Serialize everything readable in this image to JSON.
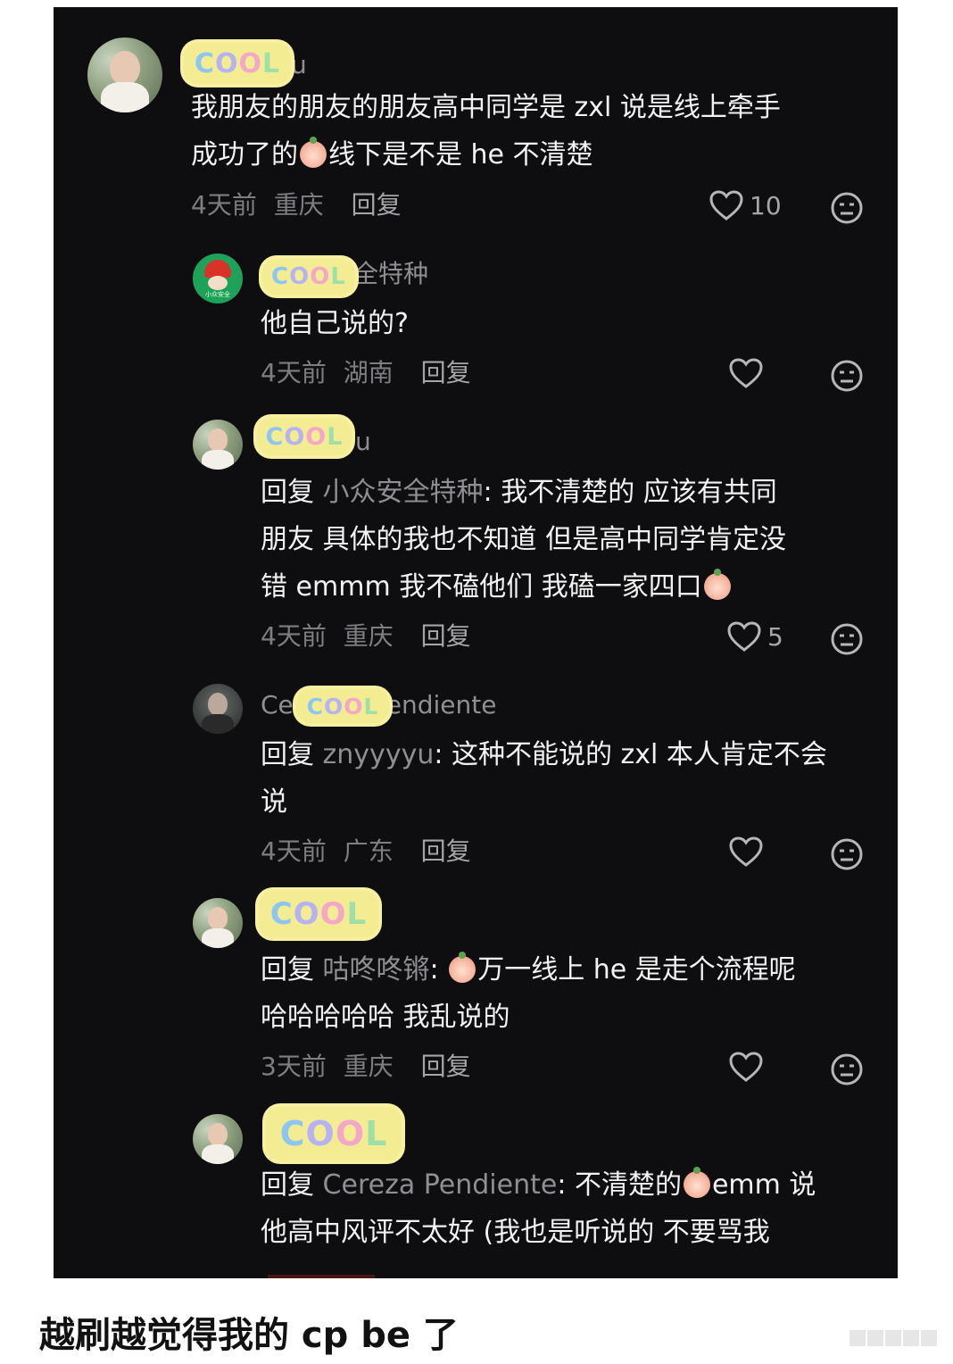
{
  "comments": [
    {
      "username_suffix": "u",
      "text_line1": "我朋友的朋友的朋友高中同学是 zxl 说是线上牵手",
      "text_line2a": "成功了的",
      "text_line2b": "线下是不是 he 不清楚",
      "time": "4天前",
      "location": "重庆",
      "reply_label": "回复",
      "likes": "10"
    },
    {
      "username_suffix": "全特种",
      "avatar_label": "小众安全",
      "text_line1": "他自己说的?",
      "time": "4天前",
      "location": "湖南",
      "reply_label": "回复",
      "likes": ""
    },
    {
      "username_suffix": "u",
      "reply_keyword": "回复",
      "reply_to": "小众安全特种",
      "text_line1": ": 我不清楚的  应该有共同",
      "text_line2": "朋友 具体的我也不知道  但是高中同学肯定没",
      "text_line3": "错 emmm 我不磕他们 我磕一家四口",
      "time": "4天前",
      "location": "重庆",
      "reply_label": "回复",
      "likes": "5"
    },
    {
      "username_prefix": "Ce",
      "username_suffix": "endiente",
      "reply_keyword": "回复",
      "reply_to": "znyyyyu",
      "text_line1": ": 这种不能说的 zxl 本人肯定不会",
      "text_line2": "说",
      "time": "4天前",
      "location": "广东",
      "reply_label": "回复",
      "likes": ""
    },
    {
      "reply_keyword": "回复",
      "reply_to": "咕咚咚锵",
      "text_line1": "万一线上 he 是走个流程呢",
      "text_line2": "哈哈哈哈哈 我乱说的",
      "time": "3天前",
      "location": "重庆",
      "reply_label": "回复",
      "likes": ""
    },
    {
      "reply_keyword": "回复",
      "reply_to": "Cereza Pendiente",
      "text_line1a": ": 不清楚的",
      "text_line1b": "emm 说",
      "text_line2": "他高中风评不太好 (我也是听说的 不要骂我"
    }
  ],
  "sticker_text": "COOL",
  "caption": "越刷越觉得我的 cp be 了",
  "colors": {
    "screen_bg": "#0e0e10",
    "text": "#f2f2f2",
    "meta": "#7d7d82",
    "sticker": "#f3ec93"
  }
}
